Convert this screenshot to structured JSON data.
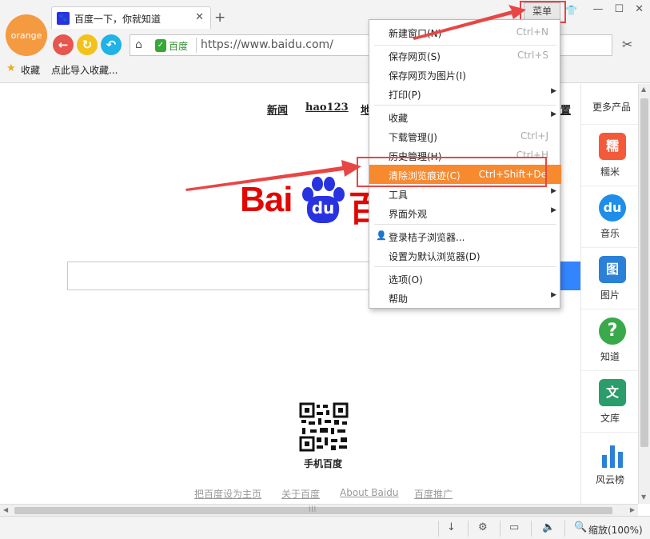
{
  "browser": {
    "brand_badge": "orange",
    "tab": {
      "title": "百度一下，你就知道",
      "favicon": "baidu-paw-icon"
    },
    "menu_button": "菜单",
    "address": {
      "site_badge": "百度",
      "url": "https://www.baidu.com/"
    },
    "bookmarks": {
      "favorites": "收藏",
      "import": "点此导入收藏..."
    }
  },
  "page": {
    "top_links": [
      "新闻",
      "hao123",
      "地",
      "置"
    ],
    "logo_text": "Bai",
    "logo_du": "du",
    "logo_hundred": "百",
    "search_button_partial": "",
    "qr_label": "手机百度",
    "footer_links": [
      "把百度设为主页",
      "关于百度",
      "About  Baidu",
      "百度推广"
    ]
  },
  "rail": {
    "title": "更多产品",
    "items": [
      {
        "label": "糯米",
        "icon": "nuomi-icon",
        "glyph": "糯",
        "color": "#f25a3a"
      },
      {
        "label": "音乐",
        "icon": "music-icon",
        "glyph": "du",
        "color": "#1e8ee8"
      },
      {
        "label": "图片",
        "icon": "image-icon",
        "glyph": "图",
        "color": "#2b80d8"
      },
      {
        "label": "知道",
        "icon": "zhidao-icon",
        "glyph": "?",
        "color": "#3aa94b"
      },
      {
        "label": "文库",
        "icon": "wenku-icon",
        "glyph": "文",
        "color": "#2a9d6a"
      },
      {
        "label": "风云榜",
        "icon": "chart-icon",
        "glyph": "",
        "color": "#2b80d8"
      }
    ]
  },
  "menu": {
    "items": [
      {
        "label": "新建窗口(N)",
        "shortcut": "Ctrl+N"
      },
      {
        "label": "保存网页(S)",
        "shortcut": "Ctrl+S"
      },
      {
        "label": "保存网页为图片(I)",
        "shortcut": ""
      },
      {
        "label": "打印(P)",
        "shortcut": "",
        "submenu": true
      },
      {
        "label": "收藏",
        "shortcut": "",
        "submenu": true
      },
      {
        "label": "下载管理(J)",
        "shortcut": "Ctrl+J"
      },
      {
        "label": "历史管理(H)",
        "shortcut": "Ctrl+H"
      },
      {
        "label": "清除浏览痕迹(C)",
        "shortcut": "Ctrl+Shift+De",
        "highlighted": true
      },
      {
        "label": "工具",
        "shortcut": "",
        "submenu": true
      },
      {
        "label": "界面外观",
        "shortcut": "",
        "submenu": true
      },
      {
        "label": "登录桔子浏览器...",
        "shortcut": ""
      },
      {
        "label": "设置为默认浏览器(D)",
        "shortcut": ""
      },
      {
        "label": "选项(O)",
        "shortcut": ""
      },
      {
        "label": "帮助",
        "shortcut": "",
        "submenu": true
      }
    ]
  },
  "status": {
    "zoom": "缩放(100%)"
  },
  "colors": {
    "accent": "#f7892f",
    "annotation": "#e84545"
  }
}
